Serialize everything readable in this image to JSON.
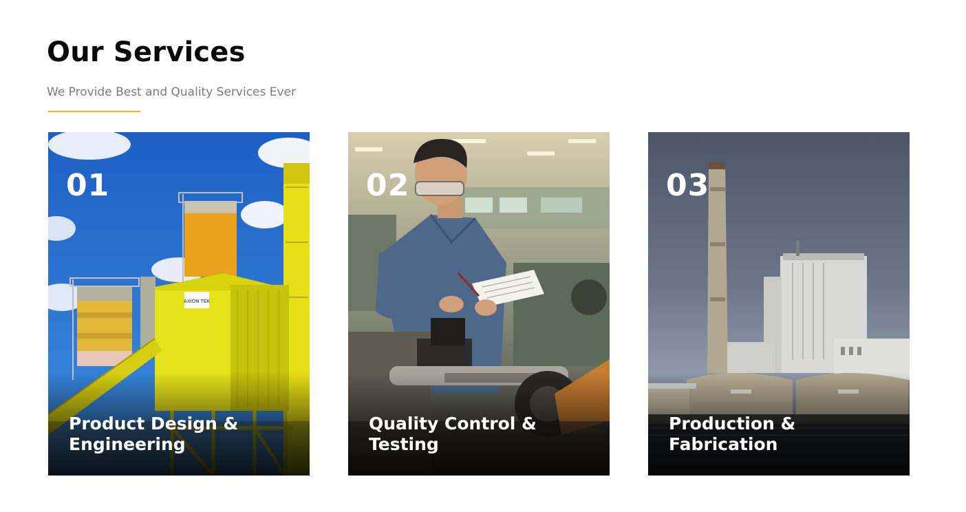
{
  "header": {
    "title": "Our Services",
    "subtitle": "We Provide Best and Quality Services Ever",
    "accent_color": "#f2b21b"
  },
  "services": [
    {
      "number": "01",
      "label": "Product Design & Engineering",
      "sign_text": "AXION TEK",
      "image": "yellow industrial silos and conveyor plant under blue sky"
    },
    {
      "number": "02",
      "label": "Quality Control & Testing",
      "image": "worker with safety glasses taking notes at a lathe in a workshop"
    },
    {
      "number": "03",
      "label": "Production & Fabrication",
      "image": "factory with tall chimney and warehouses under grey sky"
    }
  ]
}
